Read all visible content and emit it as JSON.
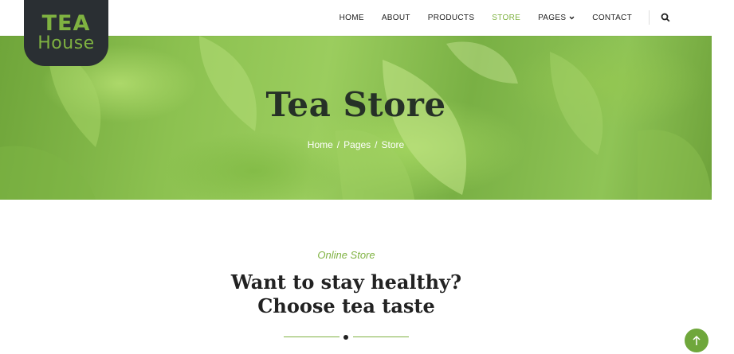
{
  "brand": {
    "logo_top": "TEA",
    "logo_bottom": "House"
  },
  "nav": {
    "items": [
      {
        "label": "HOME",
        "active": false
      },
      {
        "label": "ABOUT",
        "active": false
      },
      {
        "label": "PRODUCTS",
        "active": false
      },
      {
        "label": "STORE",
        "active": true
      },
      {
        "label": "PAGES",
        "active": false,
        "has_dropdown": true
      },
      {
        "label": "CONTACT",
        "active": false
      }
    ],
    "search_icon": "search-icon"
  },
  "hero": {
    "title": "Tea Store",
    "breadcrumb": {
      "items": [
        "Home",
        "Pages",
        "Store"
      ],
      "separator": "/"
    }
  },
  "section": {
    "eyebrow": "Online Store",
    "heading_line1": "Want to stay healthy?",
    "heading_line2": "Choose tea taste"
  },
  "back_to_top_icon": "arrow-up-icon",
  "colors": {
    "accent": "#7fb241",
    "dark": "#2a2f33",
    "text": "#222222"
  }
}
